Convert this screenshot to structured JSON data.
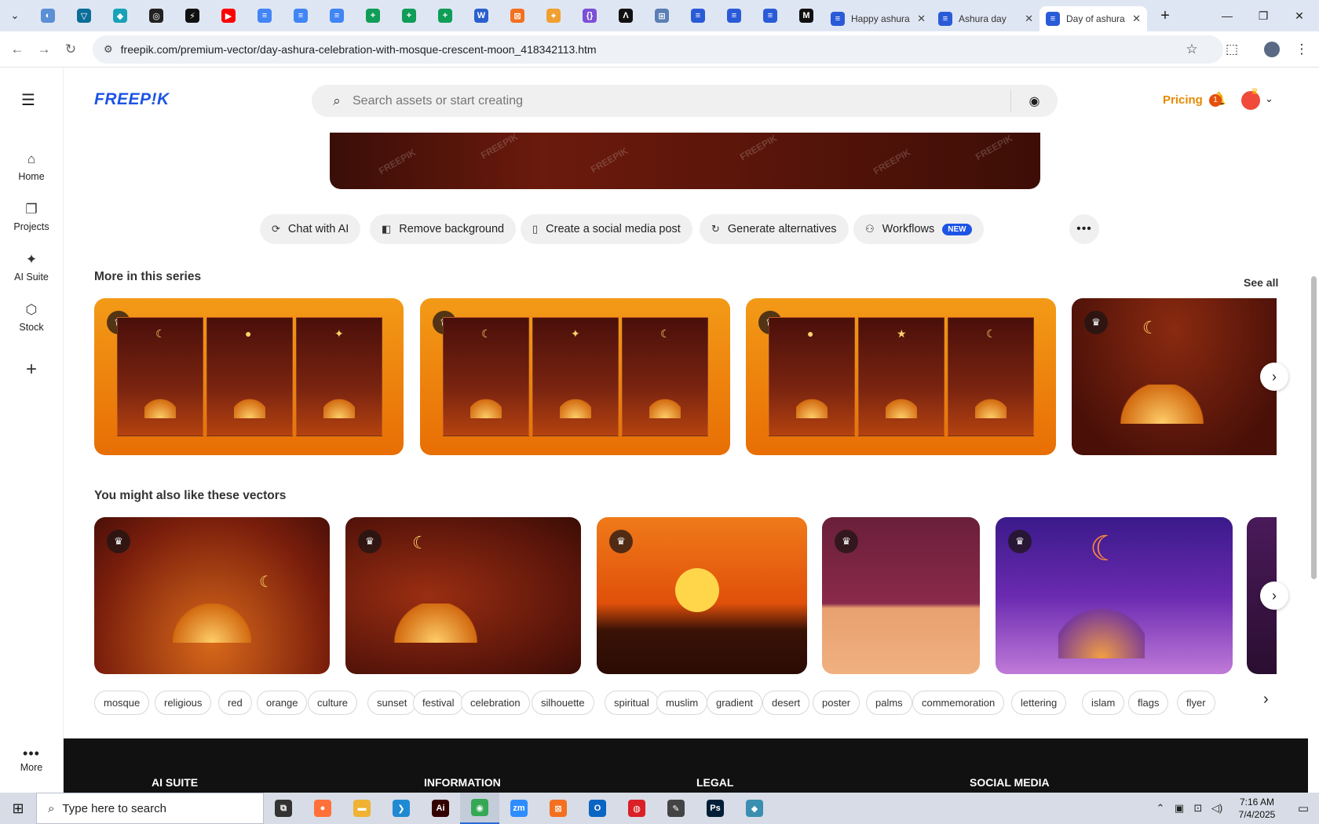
{
  "browser": {
    "favicon_tabs": [
      {
        "name": "tab-generic-1",
        "glyph": "◐",
        "color": "#5b8fd6"
      },
      {
        "name": "tab-generic-2",
        "glyph": "▽",
        "color": "#0b6e99"
      },
      {
        "name": "tab-generic-3",
        "glyph": "◆",
        "color": "#17a2b8"
      },
      {
        "name": "tab-generic-4",
        "glyph": "◎",
        "color": "#222222"
      },
      {
        "name": "tab-generic-5",
        "glyph": "⚡",
        "color": "#111111"
      },
      {
        "name": "tab-youtube",
        "glyph": "▶",
        "color": "#ff0000"
      },
      {
        "name": "tab-docs-1",
        "glyph": "≡",
        "color": "#4285f4"
      },
      {
        "name": "tab-docs-2",
        "glyph": "≡",
        "color": "#4285f4"
      },
      {
        "name": "tab-docs-3",
        "glyph": "≡",
        "color": "#4285f4"
      },
      {
        "name": "tab-sheets-1",
        "glyph": "+",
        "color": "#0f9d58"
      },
      {
        "name": "tab-sheets-2",
        "glyph": "+",
        "color": "#0f9d58"
      },
      {
        "name": "tab-sheets-3",
        "glyph": "+",
        "color": "#0f9d58"
      },
      {
        "name": "tab-word",
        "glyph": "W",
        "color": "#2b5fce"
      },
      {
        "name": "tab-xampp",
        "glyph": "⊠",
        "color": "#f37021"
      },
      {
        "name": "tab-generic-6",
        "glyph": "✦",
        "color": "#f0a030"
      },
      {
        "name": "tab-generic-7",
        "glyph": "{}",
        "color": "#7b4fd6"
      },
      {
        "name": "tab-generic-8",
        "glyph": "Λ",
        "color": "#111111"
      },
      {
        "name": "tab-generic-9",
        "glyph": "⊞",
        "color": "#5a7fb5"
      },
      {
        "name": "tab-forms-1",
        "glyph": "≡",
        "color": "#2a5bd7"
      },
      {
        "name": "tab-forms-2",
        "glyph": "≡",
        "color": "#2a5bd7"
      },
      {
        "name": "tab-forms-3",
        "glyph": "≡",
        "color": "#2a5bd7"
      },
      {
        "name": "tab-medium",
        "glyph": "M",
        "color": "#111111"
      }
    ],
    "named_tabs": [
      {
        "title": "Happy ashura",
        "close": "✕",
        "active": false
      },
      {
        "title": "Ashura day",
        "close": "✕",
        "active": false
      },
      {
        "title": "Day of ashura",
        "close": "✕",
        "active": true
      }
    ],
    "new_tab": "+",
    "url": "freepik.com/premium-vector/day-ashura-celebration-with-mosque-crescent-moon_418342113.htm"
  },
  "sidebar": {
    "items": [
      {
        "label": "Home",
        "icon": "⌂"
      },
      {
        "label": "Projects",
        "icon": "❐"
      },
      {
        "label": "AI Suite",
        "icon": "✦"
      },
      {
        "label": "Stock",
        "icon": "⬡"
      }
    ],
    "add_icon": "+",
    "more_label": "More"
  },
  "header": {
    "logo": "FREEP!K",
    "search_placeholder": "Search assets or start creating",
    "pricing": "Pricing",
    "notification_count": "1"
  },
  "actions": [
    {
      "label": "Chat with AI",
      "icon": "⟳"
    },
    {
      "label": "Remove background",
      "icon": "◧"
    },
    {
      "label": "Create a social media post",
      "icon": "▯"
    },
    {
      "label": "Generate alternatives",
      "icon": "↻"
    },
    {
      "label": "Workflows",
      "icon": "⚇",
      "badge": "NEW"
    }
  ],
  "series": {
    "title": "More in this series",
    "see_all": "See all"
  },
  "similar": {
    "title": "You might also like these vectors"
  },
  "tags": [
    "mosque",
    "religious",
    "red",
    "orange",
    "culture",
    "sunset",
    "festival",
    "celebration",
    "silhouette",
    "spiritual",
    "muslim",
    "gradient",
    "desert",
    "poster",
    "palms",
    "commemoration",
    "lettering",
    "islam",
    "flags",
    "flyer"
  ],
  "footer": {
    "headings": [
      "AI SUITE",
      "INFORMATION",
      "LEGAL",
      "SOCIAL MEDIA"
    ]
  },
  "taskbar": {
    "search_placeholder": "Type here to search",
    "apps": [
      {
        "name": "task-view",
        "glyph": "⧉",
        "color": "#333333"
      },
      {
        "name": "firefox",
        "glyph": "●",
        "color": "#ff7139"
      },
      {
        "name": "file-explorer",
        "glyph": "▬",
        "color": "#f0b232"
      },
      {
        "name": "vscode",
        "glyph": "❯",
        "color": "#1f8ad2"
      },
      {
        "name": "illustrator",
        "glyph": "Ai",
        "color": "#330000"
      },
      {
        "name": "chrome",
        "glyph": "◉",
        "color": "#34a853"
      },
      {
        "name": "zoom",
        "glyph": "zm",
        "color": "#2d8cff"
      },
      {
        "name": "xampp",
        "glyph": "⊠",
        "color": "#f37021"
      },
      {
        "name": "outlook",
        "glyph": "O",
        "color": "#0a64c2"
      },
      {
        "name": "creative-cloud",
        "glyph": "◍",
        "color": "#da1f26"
      },
      {
        "name": "pen-tool",
        "glyph": "✎",
        "color": "#444444"
      },
      {
        "name": "photoshop",
        "glyph": "Ps",
        "color": "#001e36"
      },
      {
        "name": "app-gem",
        "glyph": "◆",
        "color": "#3a8fb0"
      }
    ],
    "time": "7:16 AM",
    "date": "7/4/2025"
  }
}
